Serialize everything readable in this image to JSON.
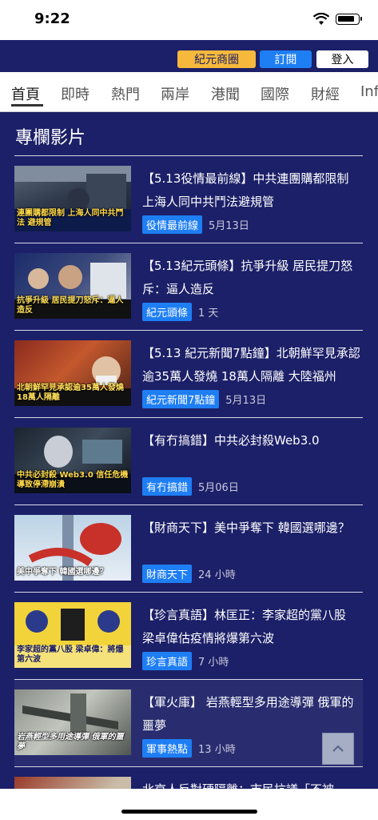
{
  "status": {
    "time": "9:22"
  },
  "header": {
    "shop_label": "紀元商圈",
    "subscribe_label": "訂閱",
    "login_label": "登入"
  },
  "nav": {
    "items": [
      "首頁",
      "即時",
      "熱門",
      "兩岸",
      "港聞",
      "國際",
      "財經",
      "Inf"
    ]
  },
  "section": {
    "title": "專欄影片"
  },
  "articles": [
    {
      "title": "【5.13役情最前線】中共連團購都限制 上海人同中共鬥法避規管",
      "tag": "役情最前線",
      "date": "5月13日",
      "thumb_caption": "連團購都限制 上海人同中共鬥法 避規管"
    },
    {
      "title": "【5.13紀元頭條】抗爭升級 居民提刀怒斥：逼人造反",
      "tag": "紀元頭條",
      "date": "1 天",
      "thumb_caption": "抗爭升級 居民提刀怒斥：逼人造反"
    },
    {
      "title": "【5.13 紀元新聞7點鐘】北朝鮮罕見承認逾35萬人發燒 18萬人隔離 大陸福州",
      "tag": "紀元新聞7點鐘",
      "date": "5月13日",
      "thumb_caption": "北朝鮮罕見承認逾35萬人發燒 18萬人隔離"
    },
    {
      "title": "【有冇搞錯】中共必封殺Web3.0",
      "tag": "有冇搞錯",
      "date": "5月06日",
      "thumb_caption": "中共必封殺 Web3.0 信任危機導致停滯崩潰"
    },
    {
      "title": "【財商天下】美中爭奪下 韓國選哪邊？",
      "tag": "財商天下",
      "date": "24 小時",
      "thumb_caption": "美中爭奪下 韓國選哪邊？"
    },
    {
      "title": "【珍言真語】林匡正：李家超的黨八股　梁卓偉估疫情將爆第六波",
      "tag": "珍言真語",
      "date": "7 小時",
      "thumb_caption": "李家超的黨八股 梁卓偉：將爆第六波"
    },
    {
      "title": "【軍火庫】 岩燕輕型多用途導彈 俄軍的噩夢",
      "tag": "軍事熱點",
      "date": "13 小時",
      "thumb_caption": "岩燕輕型多用途導彈 俄軍的噩夢"
    },
    {
      "title": "北京人反對硬隔離：市民抗議「不被",
      "tag": "",
      "date": "",
      "thumb_caption": ""
    }
  ]
}
